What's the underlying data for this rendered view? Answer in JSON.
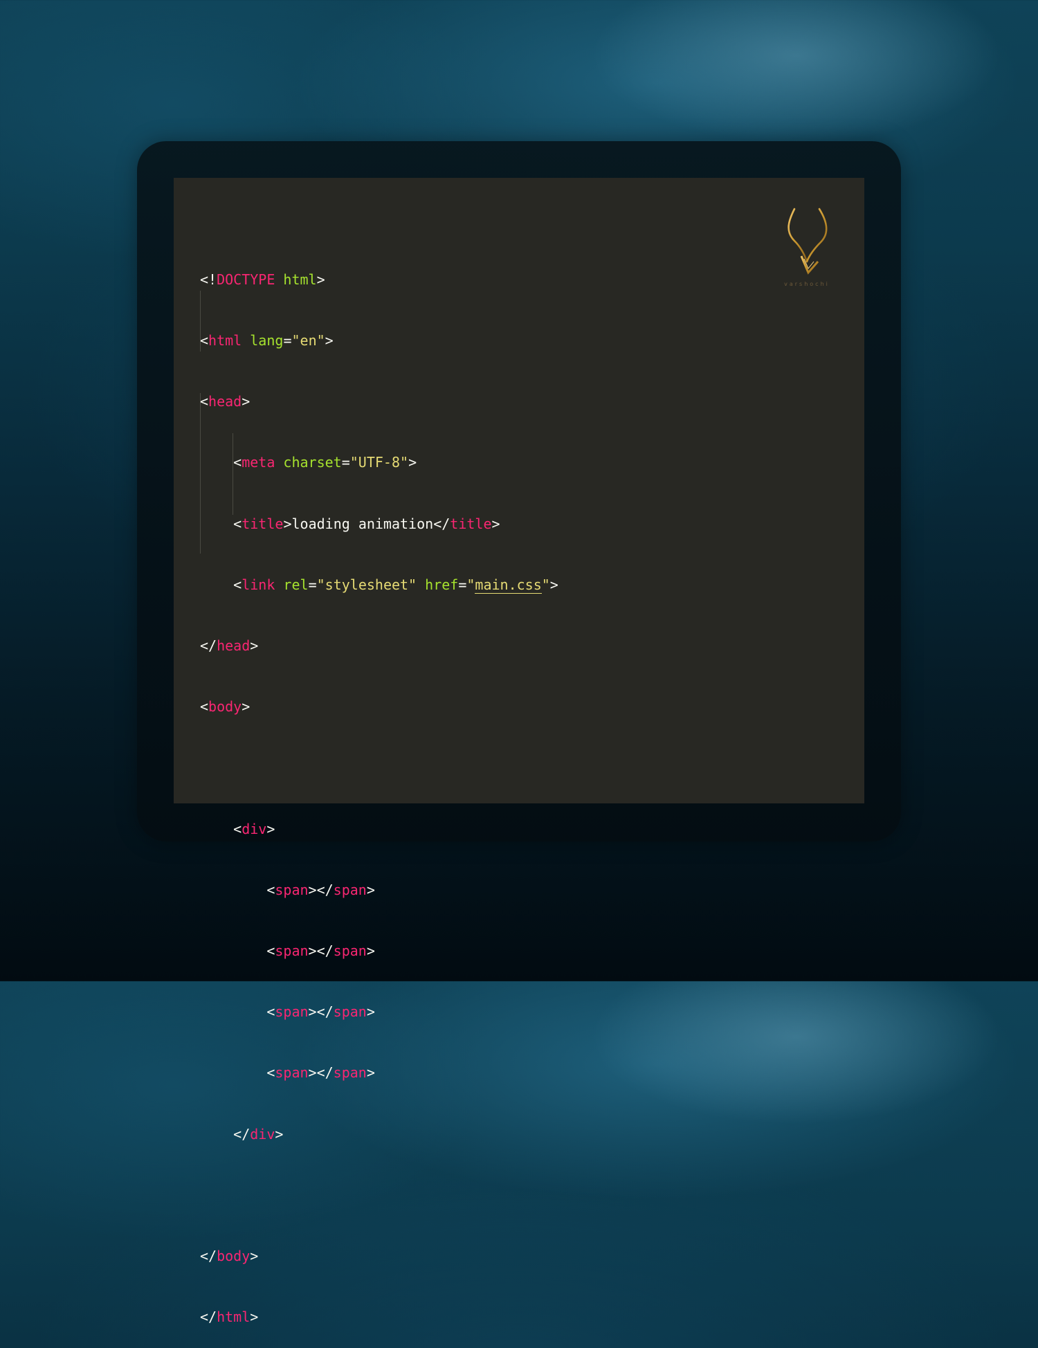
{
  "editor": {
    "theme_colors": {
      "background": "#282823",
      "tag": "#f92672",
      "attribute": "#a6e22e",
      "string": "#e6db74",
      "text": "#f8f8f2"
    },
    "lines": [
      {
        "p1": "<!",
        "t1": "DOCTYPE",
        "a1": " html",
        "p2": ">"
      },
      {
        "p1": "<",
        "t1": "html",
        "a1": " lang",
        "p2": "=",
        "s1": "\"en\"",
        "p3": ">"
      },
      {
        "p1": "<",
        "t1": "head",
        "p2": ">"
      },
      {
        "p1": "<",
        "t1": "meta",
        "a1": " charset",
        "p2": "=",
        "s1": "\"UTF-8\"",
        "p3": ">"
      },
      {
        "p1": "<",
        "t1": "title",
        "p2": ">",
        "x1": "loading animation",
        "p3": "</",
        "t2": "title",
        "p4": ">"
      },
      {
        "p1": "<",
        "t1": "link",
        "a1": " rel",
        "p2": "=",
        "s1": "\"stylesheet\"",
        "a2": " href",
        "p3": "=",
        "s2a": "\"",
        "s2": "main.css",
        "s2b": "\"",
        "p4": ">"
      },
      {
        "p1": "</",
        "t1": "head",
        "p2": ">"
      },
      {
        "p1": "<",
        "t1": "body",
        "p2": ">"
      },
      {
        "p1": "<",
        "t1": "div",
        "p2": ">"
      },
      {
        "p1": "<",
        "t1": "span",
        "p2": "></",
        "t2": "span",
        "p3": ">"
      },
      {
        "p1": "<",
        "t1": "span",
        "p2": "></",
        "t2": "span",
        "p3": ">"
      },
      {
        "p1": "<",
        "t1": "span",
        "p2": "></",
        "t2": "span",
        "p3": ">"
      },
      {
        "p1": "<",
        "t1": "span",
        "p2": "></",
        "t2": "span",
        "p3": ">"
      },
      {
        "p1": "</",
        "t1": "div",
        "p2": ">"
      },
      {
        "p1": "</",
        "t1": "body",
        "p2": ">"
      },
      {
        "p1": "</",
        "t1": "html",
        "p2": ">"
      }
    ]
  },
  "logo": {
    "icon": "horned-v-emblem",
    "color": "#c8962e",
    "wordmark": "varshochi"
  }
}
